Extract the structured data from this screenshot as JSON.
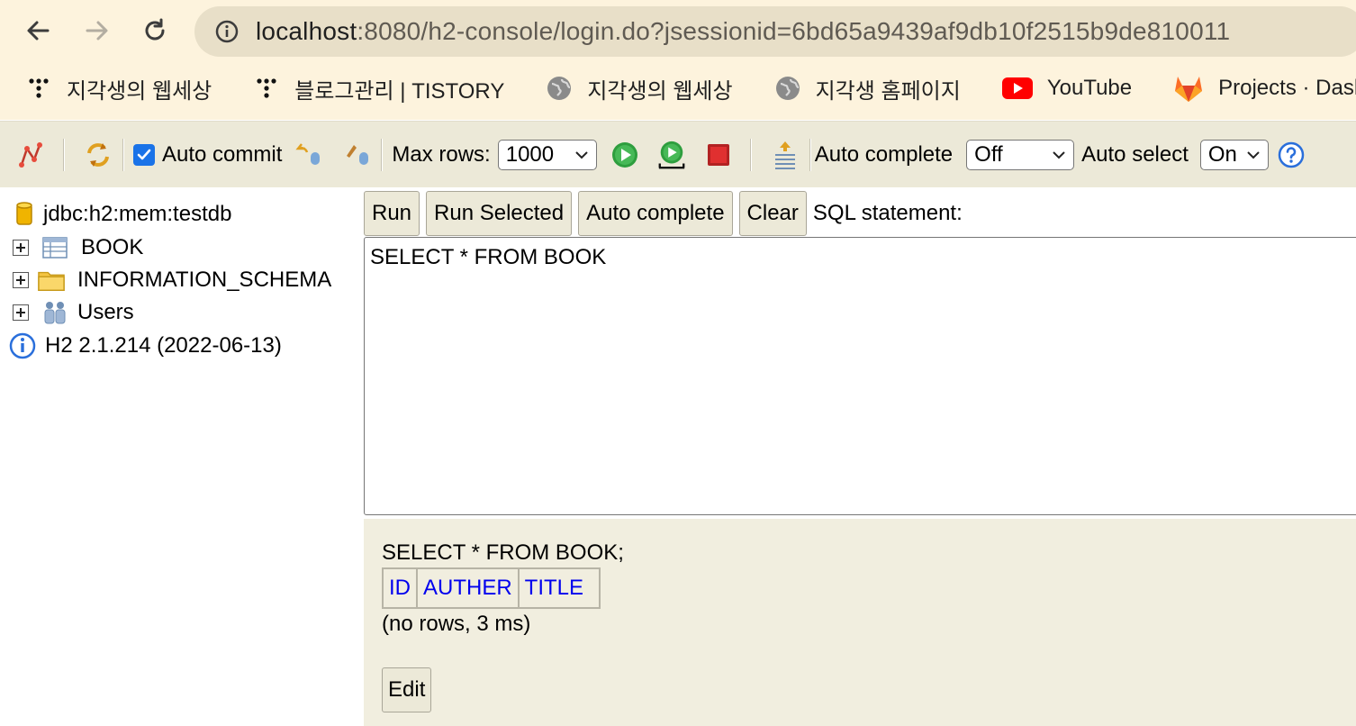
{
  "browser": {
    "url_host": "localhost",
    "url_rest": ":8080/h2-console/login.do?jsessionid=6bd65a9439af9db10f2515b9de810011",
    "bookmarks": [
      {
        "label": "지각생의 웹세상",
        "icon": "tistory-dots-icon"
      },
      {
        "label": "블로그관리 | TISTORY",
        "icon": "tistory-dots-icon"
      },
      {
        "label": "지각생의 웹세상",
        "icon": "globe-icon"
      },
      {
        "label": "지각생 홈페이지",
        "icon": "globe-icon"
      },
      {
        "label": "YouTube",
        "icon": "youtube-icon"
      },
      {
        "label": "Projects · Dashbo...",
        "icon": "gitlab-icon"
      }
    ]
  },
  "toolbar": {
    "auto_commit_label": "Auto commit",
    "auto_commit_checked": true,
    "max_rows_label": "Max rows:",
    "max_rows_value": "1000",
    "auto_complete_label": "Auto complete",
    "auto_complete_value": "Off",
    "auto_select_label": "Auto select",
    "auto_select_value": "On"
  },
  "tree": {
    "connection": "jdbc:h2:mem:testdb",
    "items": [
      {
        "label": "BOOK",
        "icon": "table-icon"
      },
      {
        "label": "INFORMATION_SCHEMA",
        "icon": "folder-icon"
      },
      {
        "label": "Users",
        "icon": "users-icon"
      }
    ],
    "version": "H2 2.1.214 (2022-06-13)"
  },
  "query": {
    "buttons": {
      "run": "Run",
      "run_selected": "Run Selected",
      "auto_complete": "Auto complete",
      "clear": "Clear"
    },
    "sql_label": "SQL statement:",
    "sql_text": "SELECT * FROM BOOK"
  },
  "result": {
    "sql": "SELECT * FROM BOOK;",
    "columns": [
      "ID",
      "AUTHER",
      "TITLE"
    ],
    "status": "(no rows, 3 ms)",
    "edit_label": "Edit"
  },
  "colors": {
    "toolbar_bg": "#ece9d8",
    "result_bg": "#f1eedf",
    "column_link": "#0000ee",
    "browser_bg": "#fdf3dd"
  }
}
